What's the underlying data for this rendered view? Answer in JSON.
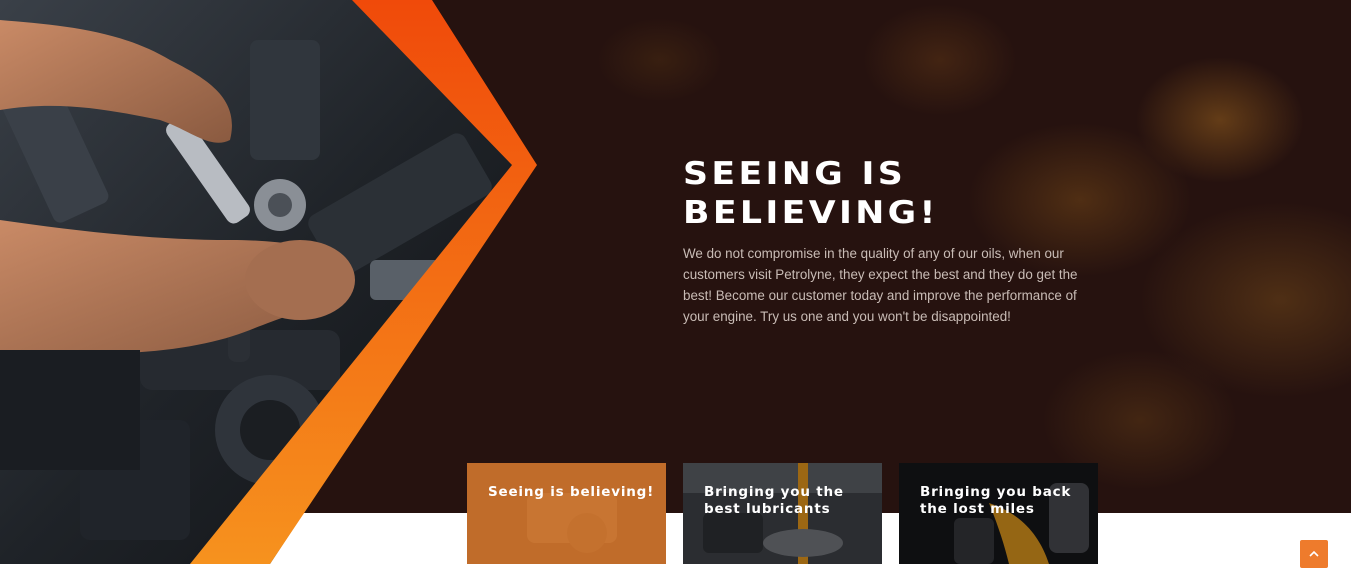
{
  "hero": {
    "title": "SEEING IS BELIEVING!",
    "description": "We do not compromise in the quality of any of our oils, when our customers visit Petrolyne, they expect the best and they do get the best! Become our customer today and improve the performance of your engine. Try us one and you won't be disappointed!"
  },
  "cards": [
    {
      "label": "Seeing is believing!"
    },
    {
      "label": "Bringing you the best lubricants"
    },
    {
      "label": "Bringing you back the lost miles"
    }
  ],
  "scroll_top": {
    "icon": "chevron-up-icon"
  },
  "colors": {
    "background": "#26120f",
    "accent_orange": "#ee7b2c",
    "chevron_top": "#f04a0a",
    "chevron_bottom": "#f6921e",
    "text_white": "#ffffff",
    "text_muted": "#c9bcb6"
  }
}
